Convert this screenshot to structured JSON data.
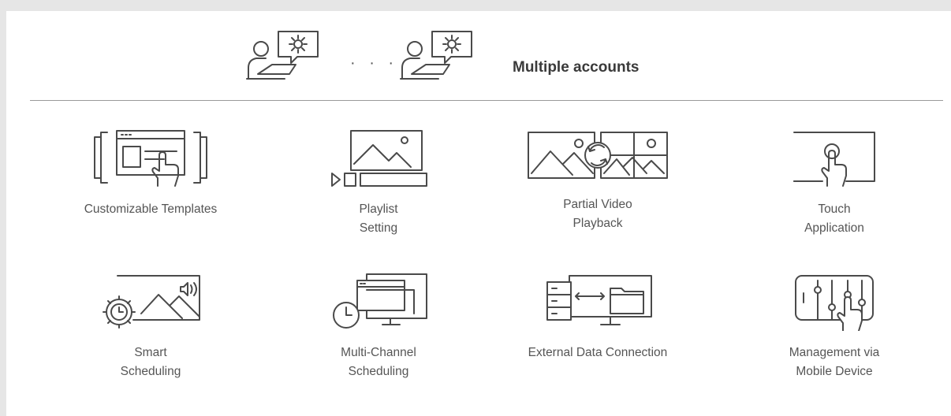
{
  "header": {
    "separator": "· · ·",
    "title": "Multiple accounts",
    "icons": [
      "user-settings-icon",
      "user-settings-icon"
    ]
  },
  "features": [
    {
      "line1": "Customizable Templates",
      "line2": "",
      "icon": "template-icon"
    },
    {
      "line1": "Playlist",
      "line2": "Setting",
      "icon": "playlist-icon"
    },
    {
      "line1": "Partial Video",
      "line2": "Playback",
      "icon": "partial-video-icon"
    },
    {
      "line1": "Touch",
      "line2": "Application",
      "icon": "touch-icon"
    },
    {
      "line1": "Smart",
      "line2": "Scheduling",
      "icon": "smart-scheduling-icon"
    },
    {
      "line1": "Multi-Channel",
      "line2": "Scheduling",
      "icon": "multi-channel-icon"
    },
    {
      "line1": "External Data Connection",
      "line2": "",
      "icon": "external-data-icon"
    },
    {
      "line1": "Management via",
      "line2": "Mobile Device",
      "icon": "mobile-management-icon"
    }
  ],
  "colors": {
    "background": "#e6e6e6",
    "card": "#ffffff",
    "icon_stroke": "#4a4a4a",
    "text": "#555555"
  }
}
